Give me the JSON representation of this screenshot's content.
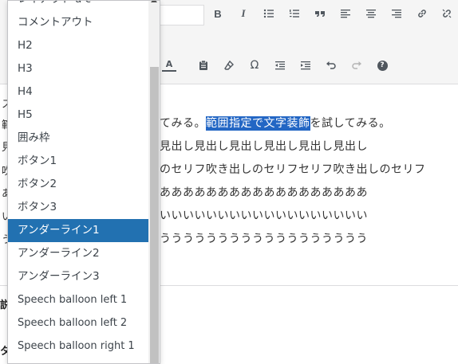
{
  "toolbar": {
    "buttons": [
      {
        "name": "bold-button",
        "label": "B"
      },
      {
        "name": "italic-button",
        "label": "I"
      },
      {
        "name": "bullet-list-button",
        "icon": "bullet-list-icon"
      },
      {
        "name": "numbered-list-button",
        "icon": "numbered-list-icon"
      },
      {
        "name": "blockquote-button",
        "icon": "quote-icon"
      },
      {
        "name": "align-left-button",
        "icon": "align-left-icon"
      },
      {
        "name": "align-center-button",
        "icon": "align-center-icon"
      },
      {
        "name": "align-right-button",
        "icon": "align-right-icon"
      },
      {
        "name": "insert-link-button",
        "icon": "link-icon"
      },
      {
        "name": "remove-link-button",
        "icon": "unlink-icon"
      }
    ],
    "row2": {
      "text_color_label": "A",
      "help_label": "?"
    }
  },
  "content": {
    "line1_pre": "てみる。",
    "line1_highlight": "範囲指定で文字装飾",
    "line1_post": "を試してみる。",
    "line2": "見出し見出し見出し見出し見出し見出し",
    "line3": "のセリフ吹き出しのセリフセリフ吹き出しのセリフ",
    "line4": "ああああああああああああああああああ",
    "line5": "いいいいいいいいいいいいいいいいいい",
    "line6": "うううううううううううううううううう",
    "left_fragments": [
      "ス",
      "範",
      "見",
      "吹",
      "あ",
      "い",
      "う"
    ],
    "below_fragments": [
      "説",
      "タ"
    ]
  },
  "dropdown": {
    "items": [
      {
        "label": "レイアウト u c",
        "selected": false
      },
      {
        "label": "コメントアウト",
        "selected": false
      },
      {
        "label": "H2",
        "selected": false
      },
      {
        "label": "H3",
        "selected": false
      },
      {
        "label": "H4",
        "selected": false
      },
      {
        "label": "H5",
        "selected": false
      },
      {
        "label": "囲み枠",
        "selected": false
      },
      {
        "label": "ボタン1",
        "selected": false
      },
      {
        "label": "ボタン2",
        "selected": false
      },
      {
        "label": "ボタン3",
        "selected": false
      },
      {
        "label": "アンダーライン1",
        "selected": true
      },
      {
        "label": "アンダーライン2",
        "selected": false
      },
      {
        "label": "アンダーライン3",
        "selected": false
      },
      {
        "label": "Speech balloon left 1",
        "selected": false
      },
      {
        "label": "Speech balloon left 2",
        "selected": false
      },
      {
        "label": "Speech balloon right 1",
        "selected": false
      }
    ]
  },
  "colors": {
    "selected_bg": "#2271b1",
    "highlight_bg": "#2266c4",
    "toolbar_bg": "#f5f5f5"
  }
}
